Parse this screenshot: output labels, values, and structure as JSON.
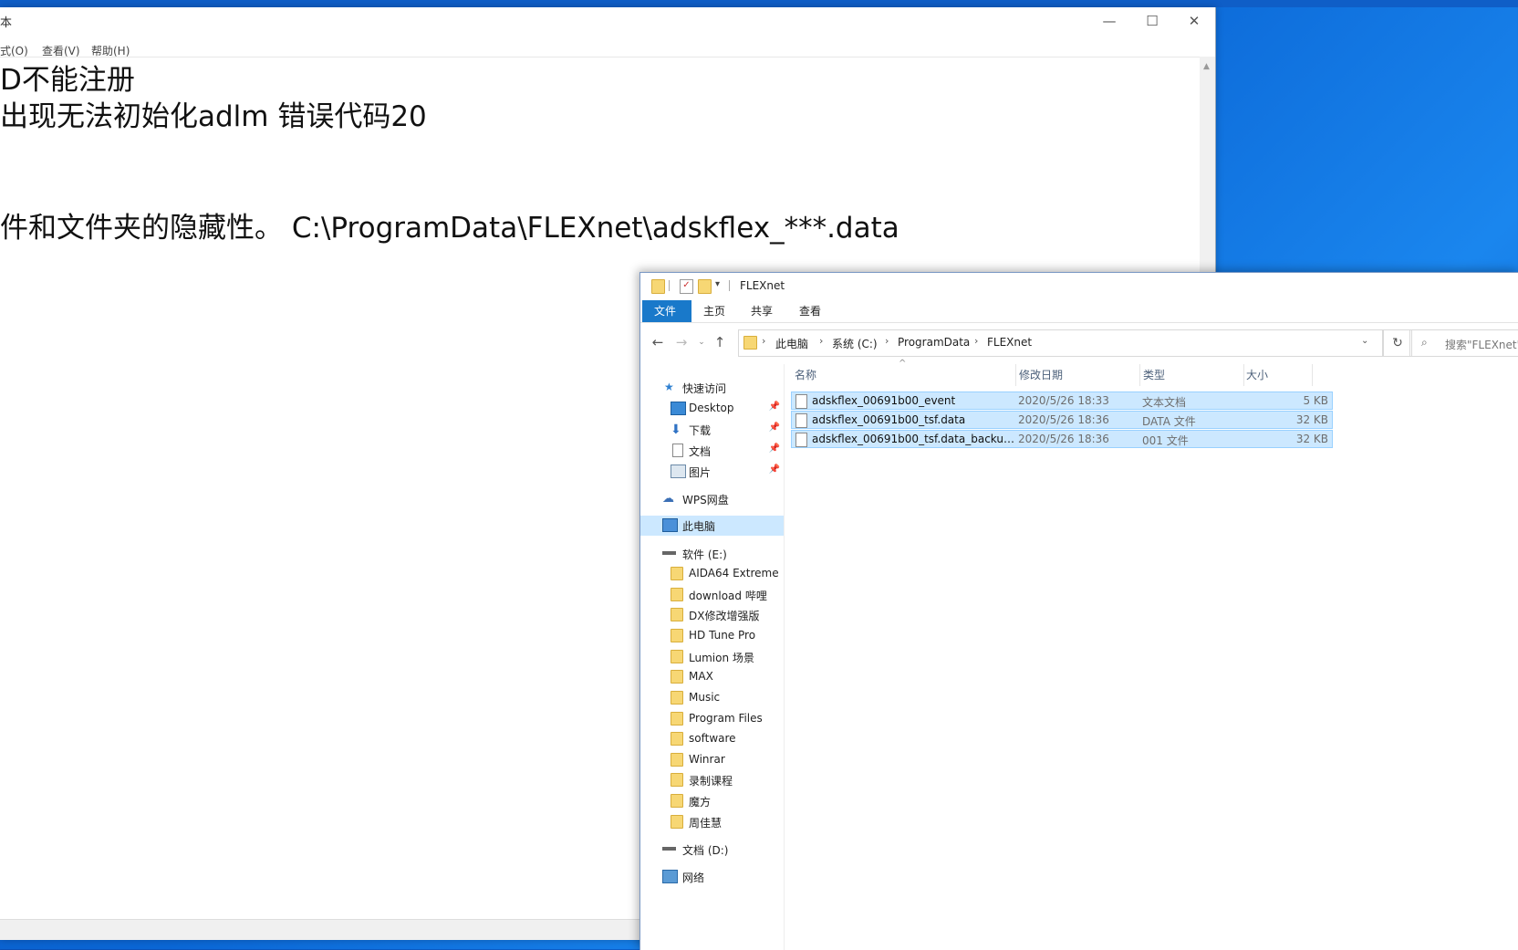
{
  "notepad": {
    "title": "本",
    "menu": [
      "式(O)",
      "查看(V)",
      "帮助(H)"
    ],
    "lines": [
      "D不能注册",
      " 出现无法初始化adlm 错误代码20",
      "",
      "",
      "件和文件夹的隐藏性。  C:\\ProgramData\\FLEXnet\\adskflex_***.data"
    ],
    "controls": {
      "minimize": "—",
      "maximize": "☐",
      "close": "✕"
    }
  },
  "explorer": {
    "title": "FLEXnet",
    "ribbon_tabs": [
      "文件",
      "主页",
      "共享",
      "查看"
    ],
    "breadcrumb": [
      "此电脑",
      "系统 (C:)",
      "ProgramData",
      "FLEXnet"
    ],
    "search_placeholder": "搜索\"FLEXnet\"",
    "nav": {
      "quick_access": "快速访问",
      "quick_items": [
        "Desktop",
        "下载",
        "文档",
        "图片"
      ],
      "wps": "WPS网盘",
      "this_pc": "此电脑",
      "drive_e": "软件 (E:)",
      "e_folders": [
        "AIDA64 Extreme",
        "download 哔哩",
        "DX修改增强版",
        "HD Tune Pro",
        "Lumion 场景",
        "MAX",
        "Music",
        "Program Files",
        "software",
        "Winrar",
        "录制课程",
        "魔方",
        "周佳慧"
      ],
      "drive_d": "文档 (D:)",
      "network": "网络"
    },
    "columns": [
      "名称",
      "修改日期",
      "类型",
      "大小"
    ],
    "files": [
      {
        "name": "adskflex_00691b00_event",
        "date": "2020/5/26 18:33",
        "type": "文本文档",
        "size": "5 KB"
      },
      {
        "name": "adskflex_00691b00_tsf.data",
        "date": "2020/5/26 18:36",
        "type": "DATA 文件",
        "size": "32 KB"
      },
      {
        "name": "adskflex_00691b00_tsf.data_backup.0...",
        "date": "2020/5/26 18:36",
        "type": "001 文件",
        "size": "32 KB"
      }
    ]
  }
}
